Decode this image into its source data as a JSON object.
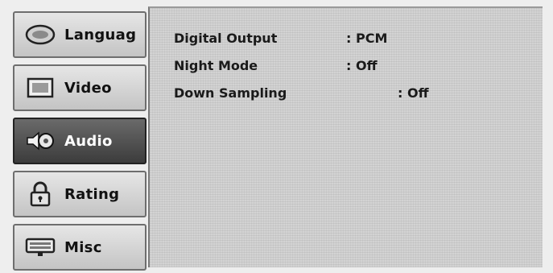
{
  "tabs": [
    {
      "label": "Languag",
      "icon": "speech-bubble-icon"
    },
    {
      "label": "Video",
      "icon": "monitor-icon"
    },
    {
      "label": "Audio",
      "icon": "speaker-icon",
      "selected": true
    },
    {
      "label": "Rating",
      "icon": "padlock-icon"
    },
    {
      "label": "Misc",
      "icon": "keyboard-icon"
    }
  ],
  "audio_settings": [
    {
      "name": "Digital Output",
      "value": ": PCM"
    },
    {
      "name": "Night Mode",
      "value": ": Off"
    },
    {
      "name": "Down Sampling",
      "value": ": Off"
    }
  ],
  "colors": {
    "selected_tab": "#4a4a4a",
    "panel": "#d3d3d3",
    "tab": "#d6d6d6"
  }
}
